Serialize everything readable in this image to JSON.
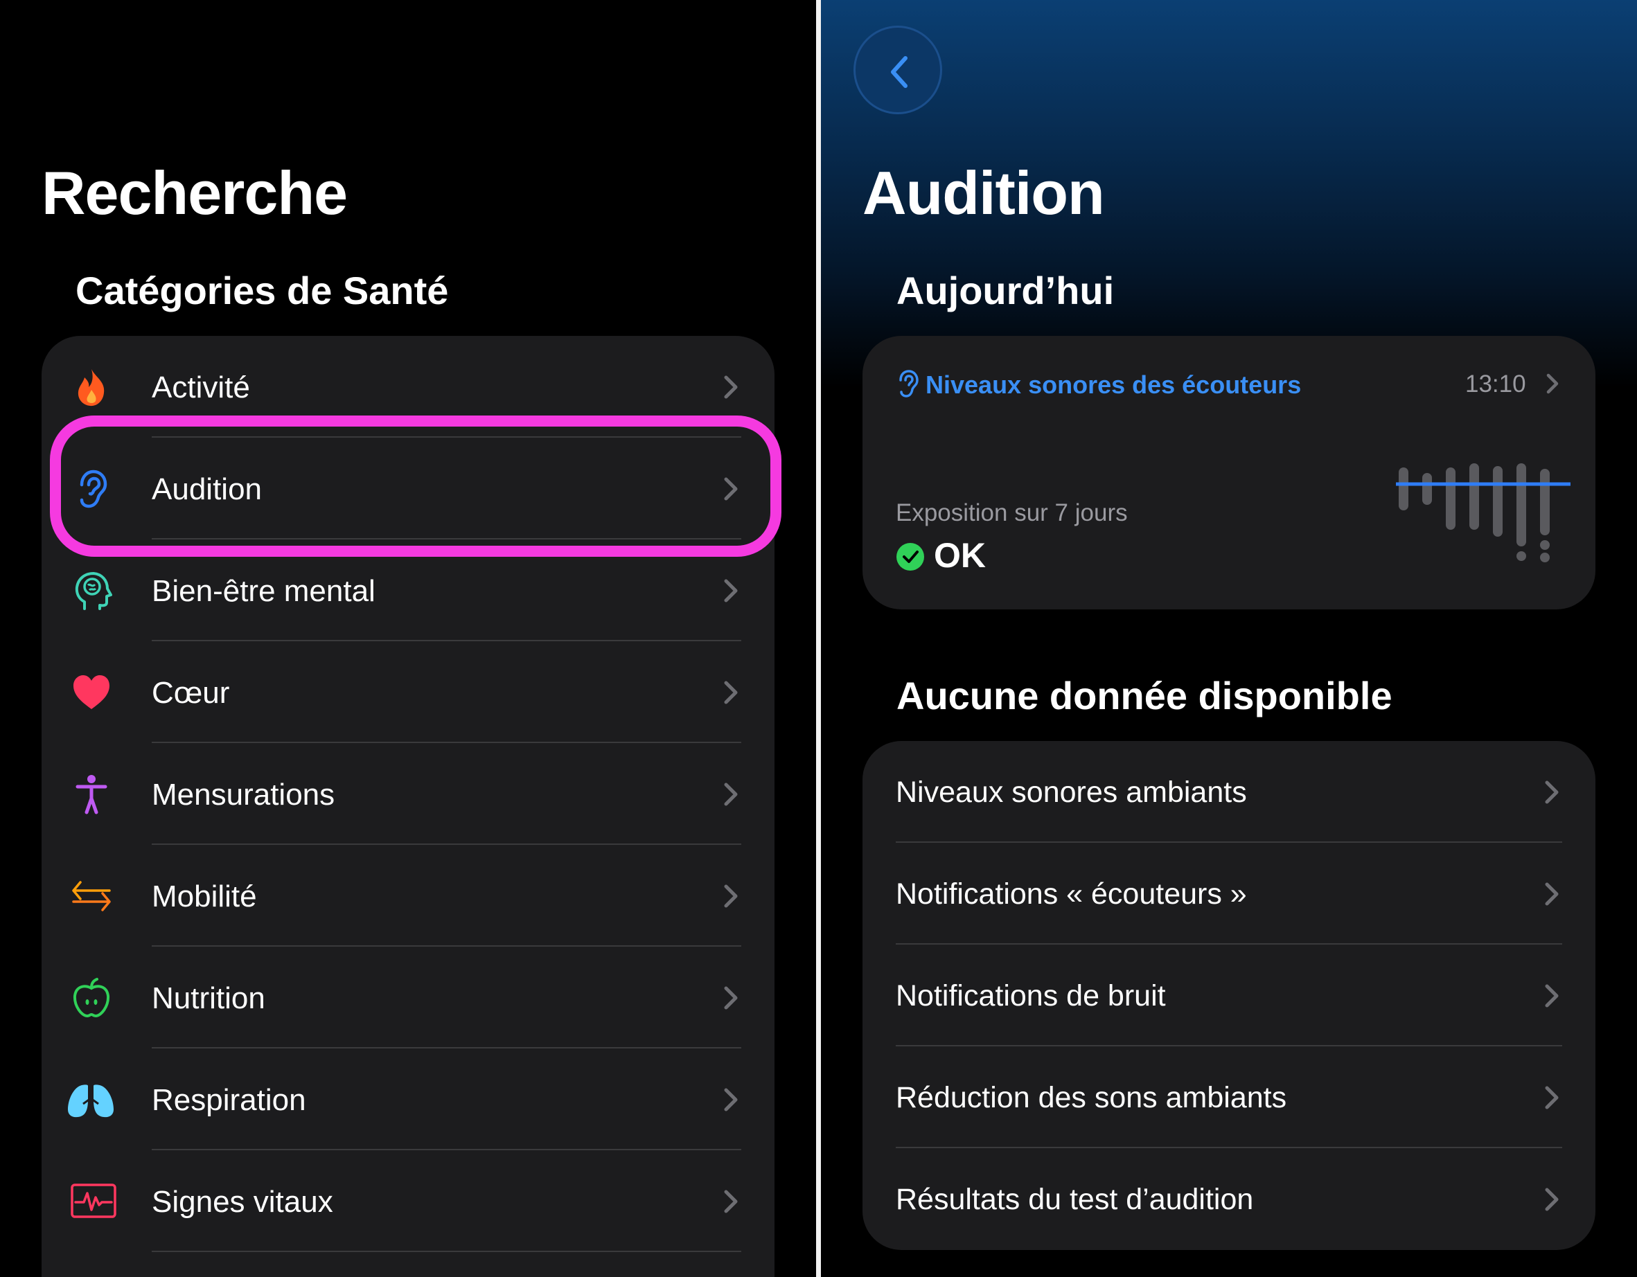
{
  "left": {
    "title": "Recherche",
    "section": "Catégories de Santé",
    "categories": [
      {
        "label": "Activité",
        "icon": "flame-icon",
        "color": "#ff5a1f"
      },
      {
        "label": "Audition",
        "icon": "ear-icon",
        "color": "#2f7df6"
      },
      {
        "label": "Bien-être mental",
        "icon": "mind-head-icon",
        "color": "#3fd3b6"
      },
      {
        "label": "Cœur",
        "icon": "heart-icon",
        "color": "#ff375f"
      },
      {
        "label": "Mensurations",
        "icon": "body-figure-icon",
        "color": "#bf5af2"
      },
      {
        "label": "Mobilité",
        "icon": "arrows-left-right-icon",
        "color": "#ff9f0a"
      },
      {
        "label": "Nutrition",
        "icon": "apple-icon",
        "color": "#30d158"
      },
      {
        "label": "Respiration",
        "icon": "lungs-icon",
        "color": "#64d2ff"
      },
      {
        "label": "Signes vitaux",
        "icon": "vitals-waveform-icon",
        "color": "#ff375f"
      }
    ],
    "highlight_color": "#f53ae0",
    "highlighted_item": "Audition"
  },
  "right": {
    "title": "Audition",
    "today_section": "Aujourd’hui",
    "exposure_card": {
      "icon": "ear-icon",
      "label": "Niveaux sonores des écouteurs",
      "time": "13:10",
      "subtitle": "Exposition sur 7 jours",
      "status": "OK",
      "status_icon": "checkmark-circle-icon",
      "status_color": "#30d158",
      "accent_color": "#3a8ff5"
    },
    "no_data_section": "Aucune donnée disponible",
    "no_data_items": [
      "Niveaux sonores ambiants",
      "Notifications « écouteurs »",
      "Notifications de bruit",
      "Réduction des sons ambiants",
      "Résultats du test d’audition"
    ]
  }
}
